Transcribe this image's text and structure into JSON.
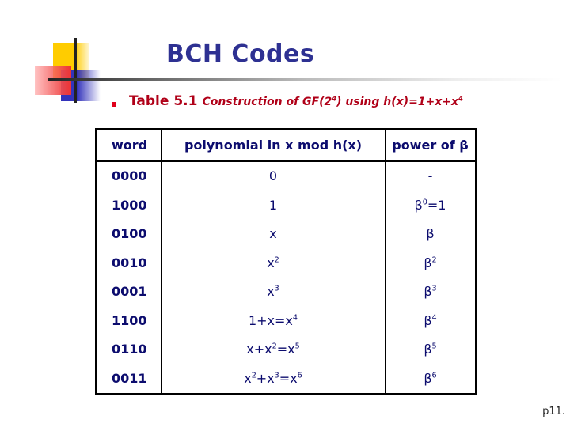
{
  "slide": {
    "title": "BCH Codes",
    "subtitle": {
      "label": "Table 5.1",
      "caption_pre": "Construction of GF(2",
      "caption_exp": "4",
      "caption_mid": ") using h(x)=1+x+x",
      "caption_exp2": "4"
    },
    "page_number": "p11."
  },
  "table": {
    "headers": [
      "word",
      "polynomial in x mod h(x)",
      "power of β"
    ],
    "rows": [
      {
        "word": "0000",
        "poly": [
          [
            "0",
            ""
          ]
        ],
        "power": [
          [
            "-",
            ""
          ]
        ]
      },
      {
        "word": "1000",
        "poly": [
          [
            "1",
            ""
          ]
        ],
        "power": [
          [
            "β",
            "0"
          ],
          [
            "=1",
            ""
          ]
        ]
      },
      {
        "word": "0100",
        "poly": [
          [
            "x",
            ""
          ]
        ],
        "power": [
          [
            "β",
            ""
          ]
        ]
      },
      {
        "word": "0010",
        "poly": [
          [
            "x",
            "2"
          ]
        ],
        "power": [
          [
            "β",
            "2"
          ]
        ]
      },
      {
        "word": "0001",
        "poly": [
          [
            "x",
            "3"
          ]
        ],
        "power": [
          [
            "β",
            "3"
          ]
        ]
      },
      {
        "word": "1100",
        "poly": [
          [
            "1+x=x",
            "4"
          ]
        ],
        "power": [
          [
            "β",
            "4"
          ]
        ]
      },
      {
        "word": "0110",
        "poly": [
          [
            "x+x",
            "2"
          ],
          [
            "=x",
            "5"
          ]
        ],
        "power": [
          [
            "β",
            "5"
          ]
        ]
      },
      {
        "word": "0011",
        "poly": [
          [
            "x",
            "2"
          ],
          [
            "+x",
            "3"
          ],
          [
            "=x",
            "6"
          ]
        ],
        "power": [
          [
            "β",
            "6"
          ]
        ]
      }
    ]
  }
}
